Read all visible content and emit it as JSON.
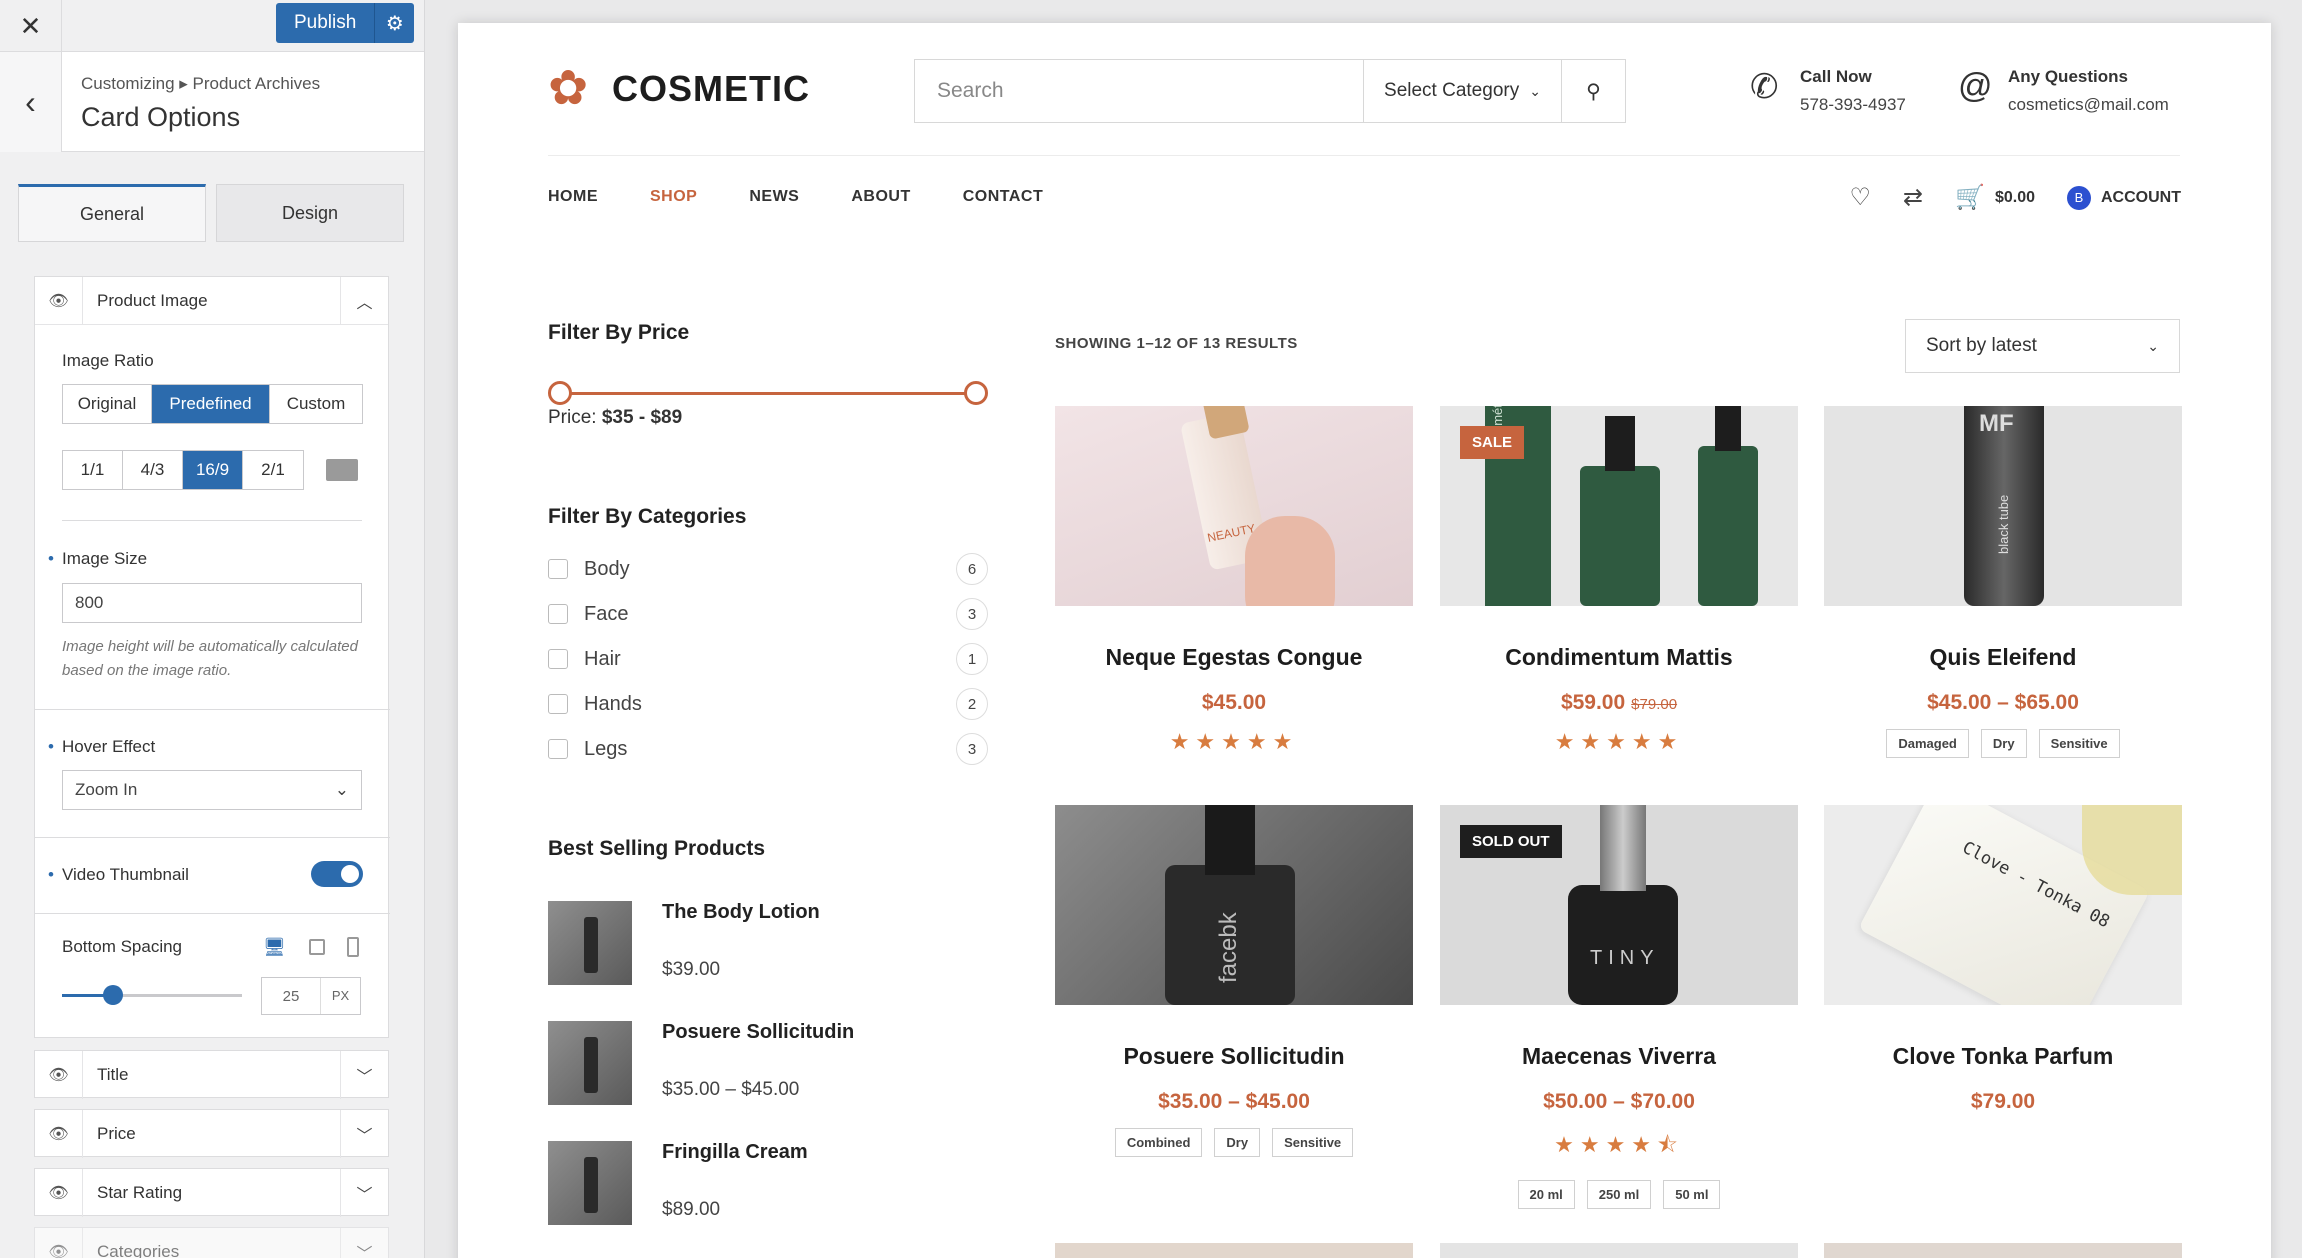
{
  "panel": {
    "close_label": "✕",
    "publish_label": "Publish",
    "breadcrumb": "Customizing ▸ Product Archives",
    "title": "Card Options",
    "tabs": [
      "General",
      "Design"
    ],
    "product_image": {
      "title": "Product Image",
      "ratio_label": "Image Ratio",
      "ratio_modes": [
        "Original",
        "Predefined",
        "Custom"
      ],
      "ratio_mode_selected": "Predefined",
      "ratio_presets": [
        "1/1",
        "4/3",
        "16/9",
        "2/1"
      ],
      "ratio_preset_selected": "16/9",
      "size_label": "Image Size",
      "size_value": "800",
      "size_hint": "Image height will be automatically calculated based on the image ratio.",
      "hover_label": "Hover Effect",
      "hover_value": "Zoom In",
      "video_label": "Video Thumbnail",
      "video_on": true,
      "spacing_label": "Bottom Spacing",
      "spacing_value": "25",
      "spacing_unit": "PX"
    },
    "collapsed_sections": [
      "Title",
      "Price",
      "Star Rating",
      "Categories"
    ]
  },
  "site": {
    "brand": "COSMETIC",
    "search_placeholder": "Search",
    "search_category": "Select Category",
    "call_label": "Call Now",
    "call_value": "578-393-4937",
    "email_label": "Any Questions",
    "email_value": "cosmetics@mail.com",
    "nav": [
      "HOME",
      "SHOP",
      "NEWS",
      "ABOUT",
      "CONTACT"
    ],
    "nav_active": "SHOP",
    "cart_total": "$0.00",
    "account_label": "ACCOUNT",
    "account_initial": "B"
  },
  "sidebar": {
    "price_title": "Filter By Price",
    "price_prefix": "Price:",
    "price_range": "$35 - $89",
    "categories_title": "Filter By Categories",
    "categories": [
      {
        "name": "Body",
        "count": "6"
      },
      {
        "name": "Face",
        "count": "3"
      },
      {
        "name": "Hair",
        "count": "1"
      },
      {
        "name": "Hands",
        "count": "2"
      },
      {
        "name": "Legs",
        "count": "3"
      }
    ],
    "best_title": "Best Selling Products",
    "best": [
      {
        "name": "The Body Lotion",
        "price": "$39.00"
      },
      {
        "name": "Posuere Sollicitudin",
        "price": "$35.00 – $45.00"
      },
      {
        "name": "Fringilla Cream",
        "price": "$89.00"
      }
    ]
  },
  "shop": {
    "results": "SHOWING 1–12 OF 13 RESULTS",
    "sort": "Sort by latest",
    "products": [
      {
        "title": "Neque Egestas Congue",
        "price": "$45.00",
        "old": "",
        "badge": "",
        "rating": 5,
        "tags": []
      },
      {
        "title": "Condimentum Mattis",
        "price": "$59.00",
        "old": "$79.00",
        "badge": "SALE",
        "rating": 5,
        "tags": []
      },
      {
        "title": "Quis Eleifend",
        "price": "$45.00 – $65.00",
        "old": "",
        "badge": "",
        "rating": 0,
        "tags": [
          "Damaged",
          "Dry",
          "Sensitive"
        ]
      },
      {
        "title": "Posuere Sollicitudin",
        "price": "$35.00 – $45.00",
        "old": "",
        "badge": "",
        "rating": 0,
        "tags": [
          "Combined",
          "Dry",
          "Sensitive"
        ]
      },
      {
        "title": "Maecenas Viverra",
        "price": "$50.00 – $70.00",
        "old": "",
        "badge": "SOLD OUT",
        "rating": 4.5,
        "tags": [
          "20 ml",
          "250 ml",
          "50 ml"
        ]
      },
      {
        "title": "Clove Tonka Parfum",
        "price": "$79.00",
        "old": "",
        "badge": "",
        "rating": 0,
        "tags": []
      }
    ],
    "image_texts": {
      "p1_label": "NEAUTY",
      "p2_label": "cosmétique",
      "p3_label": "black tube",
      "p3_logo": "MF",
      "p4_label": "facebk",
      "p5_label": "TINY",
      "p6_label": "Clove - Tonka 08"
    }
  },
  "colors": {
    "accent": "#c6643e",
    "primary": "#2c6bad"
  }
}
